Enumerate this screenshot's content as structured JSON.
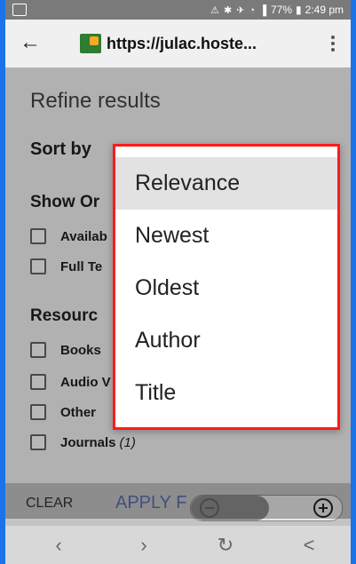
{
  "status_bar": {
    "icons": "⚠ ✱ ✈ ◔ ▐",
    "battery": "77%",
    "time": "2:49 pm"
  },
  "toolbar": {
    "url": "https://julac.hoste..."
  },
  "refine": {
    "title": "Refine results",
    "sort_by": "Sort by",
    "show_only_label": "Show Or",
    "show_only_items": [
      {
        "label": "Availab"
      },
      {
        "label": "Full Te"
      }
    ],
    "resource_label": "Resourc",
    "resource_items": [
      {
        "label": "Books"
      },
      {
        "label": "Audio V"
      },
      {
        "label": "Other"
      },
      {
        "label": "Journals",
        "count": "(1)"
      }
    ]
  },
  "actions": {
    "clear": "CLEAR",
    "apply": "APPLY F"
  },
  "sort_menu": {
    "options": [
      {
        "label": "Relevance",
        "selected": true
      },
      {
        "label": "Newest"
      },
      {
        "label": "Oldest"
      },
      {
        "label": "Author"
      },
      {
        "label": "Title"
      }
    ],
    "highlight_color": "#ff1a1a"
  },
  "colors": {
    "frame": "#1a73e8",
    "status": "#7a7a7a",
    "apply": "#5a6fb0"
  }
}
